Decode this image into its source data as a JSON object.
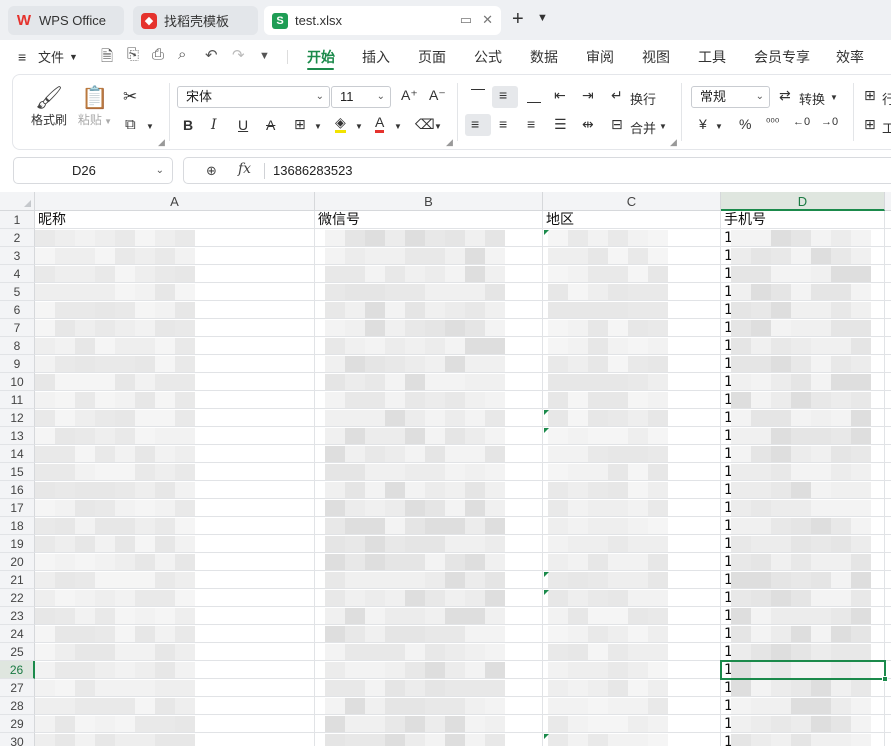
{
  "tabs": {
    "wps": "WPS Office",
    "template": "找稻壳模板",
    "file": "test.xlsx"
  },
  "menu": {
    "file_label": "文件",
    "tabs": [
      "开始",
      "插入",
      "页面",
      "公式",
      "数据",
      "审阅",
      "视图",
      "工具",
      "会员专享",
      "效率"
    ],
    "active_tab": "开始"
  },
  "ribbon": {
    "format_painter": "格式刷",
    "paste": "粘贴",
    "font_name": "宋体",
    "font_size": "11",
    "wrap_text": "换行",
    "merge": "合并",
    "number_format": "常规",
    "convert": "转换",
    "row_col": "行",
    "work": "工"
  },
  "formula_bar": {
    "cell_ref": "D26",
    "fx": "fx",
    "value": "13686283523"
  },
  "sheet": {
    "columns": [
      "A",
      "B",
      "C",
      "D"
    ],
    "selected_column": "D",
    "selected_row": 26,
    "headers": [
      "昵称",
      "微信号",
      "地区",
      "手机号"
    ],
    "rows": [
      "1",
      "2",
      "3",
      "4",
      "5",
      "6",
      "7",
      "8",
      "9",
      "10",
      "11",
      "12",
      "13",
      "14",
      "15",
      "16",
      "17",
      "18",
      "19",
      "20",
      "21",
      "22",
      "23",
      "24",
      "25",
      "26",
      "27",
      "28",
      "29",
      "30"
    ],
    "row2_a_fragment": "…",
    "phone_prefix": "1"
  },
  "colors": {
    "accent": "#1b8a4b",
    "wps_red": "#e5322d",
    "sheet_green": "#1f9d55"
  }
}
